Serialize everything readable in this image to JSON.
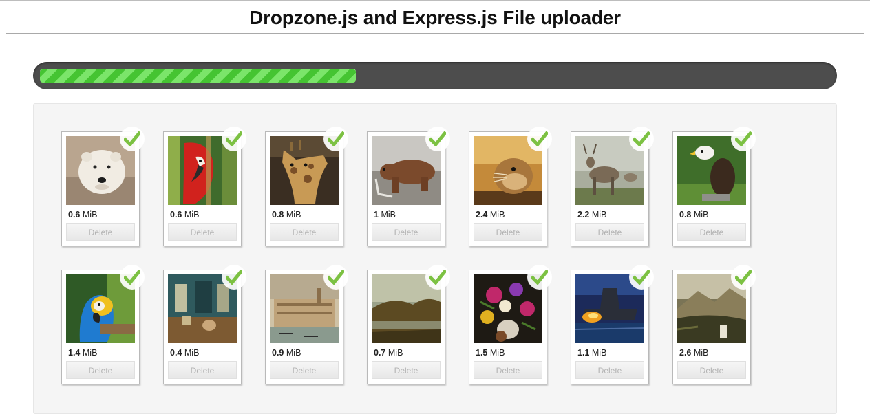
{
  "page": {
    "title": "Dropzone.js and Express.js File uploader"
  },
  "upload_progress": 0.4,
  "colors": {
    "progress_fill": "#4fcf3c",
    "progress_track": "#4d4d4d",
    "check": "#7cc142"
  },
  "files": [
    {
      "size_value": "0.6",
      "size_unit": "MiB",
      "delete_label": "Delete",
      "thumb": "polar-bear",
      "status_icon": "checkmark-icon"
    },
    {
      "size_value": "0.6",
      "size_unit": "MiB",
      "delete_label": "Delete",
      "thumb": "red-macaw",
      "status_icon": "checkmark-icon"
    },
    {
      "size_value": "0.8",
      "size_unit": "MiB",
      "delete_label": "Delete",
      "thumb": "giraffe",
      "status_icon": "checkmark-icon"
    },
    {
      "size_value": "1",
      "size_unit": "MiB",
      "delete_label": "Delete",
      "thumb": "brown-bear",
      "status_icon": "checkmark-icon"
    },
    {
      "size_value": "2.4",
      "size_unit": "MiB",
      "delete_label": "Delete",
      "thumb": "gopher",
      "status_icon": "checkmark-icon"
    },
    {
      "size_value": "2.2",
      "size_unit": "MiB",
      "delete_label": "Delete",
      "thumb": "deer",
      "status_icon": "checkmark-icon"
    },
    {
      "size_value": "0.8",
      "size_unit": "MiB",
      "delete_label": "Delete",
      "thumb": "eagle",
      "status_icon": "checkmark-icon"
    },
    {
      "size_value": "1.4",
      "size_unit": "MiB",
      "delete_label": "Delete",
      "thumb": "blue-macaw",
      "status_icon": "checkmark-icon"
    },
    {
      "size_value": "0.4",
      "size_unit": "MiB",
      "delete_label": "Delete",
      "thumb": "interior-painting",
      "status_icon": "checkmark-icon"
    },
    {
      "size_value": "0.9",
      "size_unit": "MiB",
      "delete_label": "Delete",
      "thumb": "venice-painting",
      "status_icon": "checkmark-icon"
    },
    {
      "size_value": "0.7",
      "size_unit": "MiB",
      "delete_label": "Delete",
      "thumb": "landscape-painting",
      "status_icon": "checkmark-icon"
    },
    {
      "size_value": "1.5",
      "size_unit": "MiB",
      "delete_label": "Delete",
      "thumb": "flowers-painting",
      "status_icon": "checkmark-icon"
    },
    {
      "size_value": "1.1",
      "size_unit": "MiB",
      "delete_label": "Delete",
      "thumb": "battleship-painting",
      "status_icon": "checkmark-icon"
    },
    {
      "size_value": "2.6",
      "size_unit": "MiB",
      "delete_label": "Delete",
      "thumb": "mountain-painting",
      "status_icon": "checkmark-icon"
    }
  ]
}
